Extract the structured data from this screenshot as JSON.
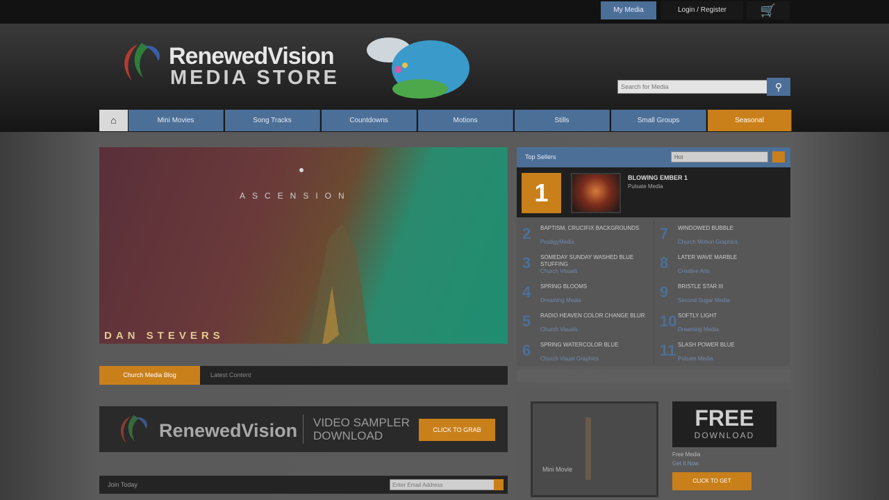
{
  "topbar": {
    "my_media_label": "My Media",
    "login_label": "Login / Register",
    "cart_icon": "cart-icon"
  },
  "header": {
    "logo_line1": "RenewedVision",
    "logo_line2": "MEDIA STORE",
    "search_placeholder": "Search for Media",
    "search_icon": "search-icon"
  },
  "nav": {
    "home_icon": "home-icon",
    "items": [
      "Mini Movies",
      "Song Tracks",
      "Countdowns",
      "Motions",
      "Stills",
      "Small Groups",
      "Seasonal"
    ]
  },
  "hero": {
    "title": "ASCENSION",
    "artist": "DAN STEVERS"
  },
  "tabs": {
    "active": "Church Media Blog",
    "inactive": "Latest Content"
  },
  "banner": {
    "logo_text": "RenewedVision",
    "headline": "VIDEO SAMPLER DOWNLOAD",
    "button_label": "CLICK TO GRAB"
  },
  "bottom_bar": {
    "label": "Join Today",
    "input_placeholder": "Enter Email Address"
  },
  "top_sellers": {
    "title": "Top Sellers",
    "select_value": "Hot",
    "first": {
      "rank": "1",
      "title": "BLOWING EMBER 1",
      "subtitle": "Pulsate Media"
    },
    "items": [
      {
        "rank": "2",
        "title": "BAPTISM, CRUCIFIX BACKGROUNDS",
        "sub": "ProdigyMedia"
      },
      {
        "rank": "3",
        "title": "SOMEDAY SUNDAY WASHED BLUE STUFFING",
        "sub": "Church Visuals"
      },
      {
        "rank": "4",
        "title": "SPRING BLOOMS",
        "sub": "Dreaming Media"
      },
      {
        "rank": "5",
        "title": "RADIO HEAVEN COLOR CHANGE BLUR",
        "sub": "Church Visuals"
      },
      {
        "rank": "6",
        "title": "SPRING WATERCOLOR BLUE",
        "sub": "Church Visual Graphics"
      },
      {
        "rank": "7",
        "title": "WINDOWED BUBBLE",
        "sub": "Church Motion Graphics"
      },
      {
        "rank": "8",
        "title": "LATER WAVE MARBLE",
        "sub": "Creative Arts"
      },
      {
        "rank": "9",
        "title": "BRISTLE STAR III",
        "sub": "Second Sugar Media"
      },
      {
        "rank": "10",
        "title": "SOFTLY LIGHT",
        "sub": "Dreaming Media"
      },
      {
        "rank": "11",
        "title": "SLASH POWER BLUE",
        "sub": "Pulsate Media"
      }
    ]
  },
  "featured": {
    "video_label": "Mini Movie",
    "free_title": "FREE",
    "free_sub": "DOWNLOAD",
    "free_label": "Free Media",
    "free_link": "Get It Now",
    "free_button": "CLICK TO GET"
  },
  "colors": {
    "accent_blue": "#4c6f98",
    "accent_orange": "#c9801a"
  }
}
